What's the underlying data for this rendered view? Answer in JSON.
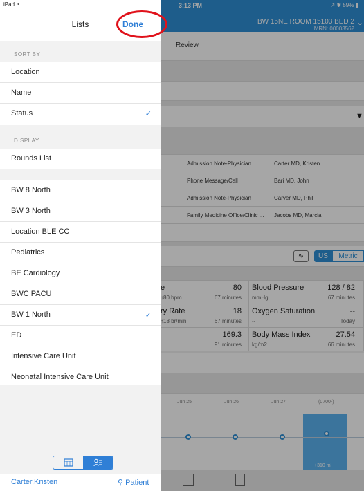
{
  "status_bar": {
    "carrier": "iPad",
    "time": "3:13 PM",
    "battery": "59%"
  },
  "header": {
    "room": "BW 15NE ROOM 15103 BED 2",
    "mrn": "MRN: 00003562"
  },
  "background": {
    "review_label": "Review",
    "notes": [
      {
        "type": "Admission Note-Physician",
        "author": "Carter MD, Kristen"
      },
      {
        "type": "Phone Message/Call",
        "author": "Bari MD, John"
      },
      {
        "type": "Admission Note-Physician",
        "author": "Carver MD, Phil"
      },
      {
        "type": "Family Medicine Office/Clinic ...",
        "author": "Jacobs MD, Marcia"
      }
    ],
    "units": {
      "us": "US",
      "metric": "Metric"
    },
    "vitals": [
      {
        "name": "e",
        "value": "80",
        "sub1": "↑80 bpm",
        "sub2": "67 minutes"
      },
      {
        "name": "Blood Pressure",
        "value": "128 / 82",
        "sub1": "mmHg",
        "sub2": "67 minutes"
      },
      {
        "name": "ry Rate",
        "value": "18",
        "sub1": "↑18 br/min",
        "sub2": "67 minutes"
      },
      {
        "name": "Oxygen Saturation",
        "value": "--",
        "sub1": "--",
        "sub2": "Today"
      },
      {
        "name": "",
        "value": "169.3",
        "sub1": "",
        "sub2": "91 minutes"
      },
      {
        "name": "Body Mass Index",
        "value": "27.54",
        "sub1": "kg/m2",
        "sub2": "66 minutes"
      }
    ],
    "chart_dates": [
      "Jun 25",
      "Jun 26",
      "Jun 27",
      "(0700-)"
    ],
    "chart_value": "+310 ml"
  },
  "panel": {
    "title": "Lists",
    "done": "Done",
    "sort_by": "SORT BY",
    "sort_items": [
      {
        "label": "Location",
        "checked": false
      },
      {
        "label": "Name",
        "checked": false
      },
      {
        "label": "Status",
        "checked": true
      }
    ],
    "display": "DISPLAY",
    "display_items": [
      {
        "label": "Rounds List"
      }
    ],
    "lists": [
      {
        "label": "BW 8 North",
        "checked": false
      },
      {
        "label": "BW 3 North",
        "checked": false
      },
      {
        "label": "Location BLE CC",
        "checked": false
      },
      {
        "label": "Pediatrics",
        "checked": false
      },
      {
        "label": "BE Cardiology",
        "checked": false
      },
      {
        "label": "BWC PACU",
        "checked": false
      },
      {
        "label": "BW 1 North",
        "checked": true
      },
      {
        "label": "ED",
        "checked": false
      },
      {
        "label": "Intensive Care Unit",
        "checked": false
      },
      {
        "label": "Neonatal Intensive Care Unit",
        "checked": false
      }
    ],
    "check_glyph": "✓",
    "footer_user": "Carter,Kristen",
    "footer_patient": "Patient"
  }
}
